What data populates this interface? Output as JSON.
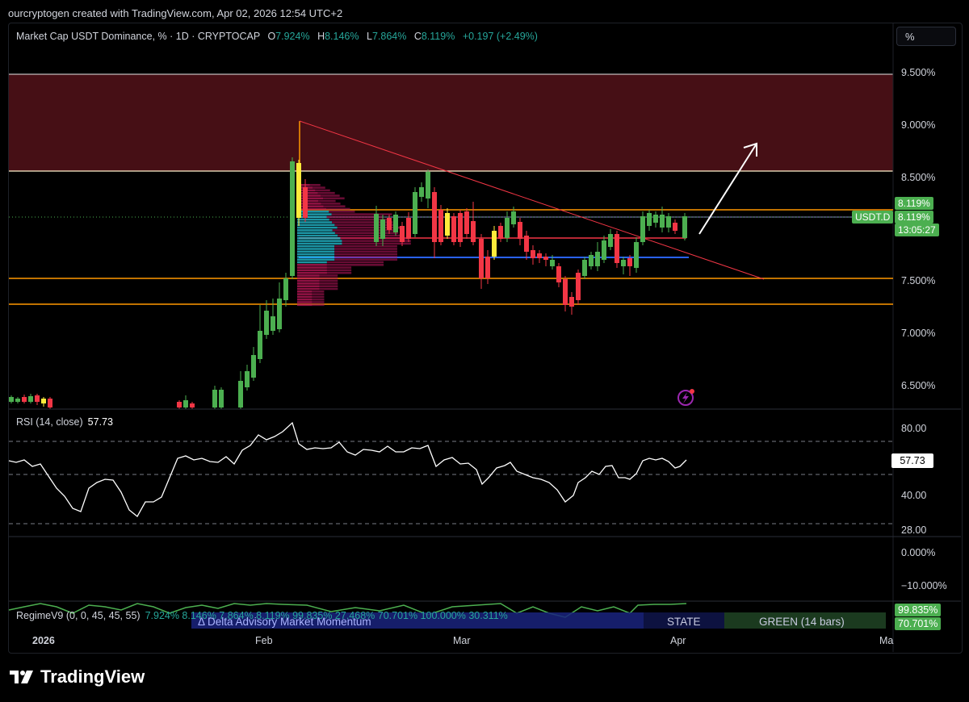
{
  "header": {
    "attribution": "ourcryptogen created with TradingView.com, Apr 02, 2026 12:54 UTC+2"
  },
  "legend": {
    "symbol": "Market Cap USDT Dominance, % · 1D · CRYPTOCAP",
    "o_label": "O",
    "o_value": "7.924%",
    "h_label": "H",
    "h_value": "8.146%",
    "l_label": "L",
    "l_value": "7.864%",
    "c_label": "C",
    "c_value": "8.119%",
    "change": "+0.197 (+2.49%)"
  },
  "scale_button": "%",
  "price_axis": [
    "9.500%",
    "9.000%",
    "8.500%",
    "8.000%",
    "7.500%",
    "7.000%",
    "6.500%"
  ],
  "price_tags": {
    "current_value": "8.119%",
    "symbol_tag": "USDT.D",
    "symbol_value": "8.119%",
    "countdown": "13:05:27"
  },
  "rsi": {
    "label": "RSI (14, close)",
    "value": "57.73",
    "axis": [
      "80.00",
      "40.00",
      "28.00"
    ]
  },
  "regime": {
    "label": "RegimeV9 (0, 0, 45, 45, 55)",
    "values": "7.924%  8.146%  7.864%  8.119%  99.835%  27.468%  70.701%  100.000%  30.311%",
    "title": "Δ Delta Advisory Market Momentum",
    "state_label": "STATE",
    "state_value": "GREEN (14 bars)",
    "axis": [
      "0.000%",
      "−10.000%"
    ],
    "badge1": "99.835%",
    "badge2": "70.701%"
  },
  "time_axis": [
    "2026",
    "Feb",
    "Mar",
    "Apr",
    "Ma"
  ],
  "brand": "TradingView",
  "colors": {
    "bull": "#4caf50",
    "bear": "#f23645",
    "resistance_zone": "#4a1016",
    "orange_line": "#ff9800",
    "blue_line": "#2962ff",
    "trend_line": "#f23645"
  }
}
